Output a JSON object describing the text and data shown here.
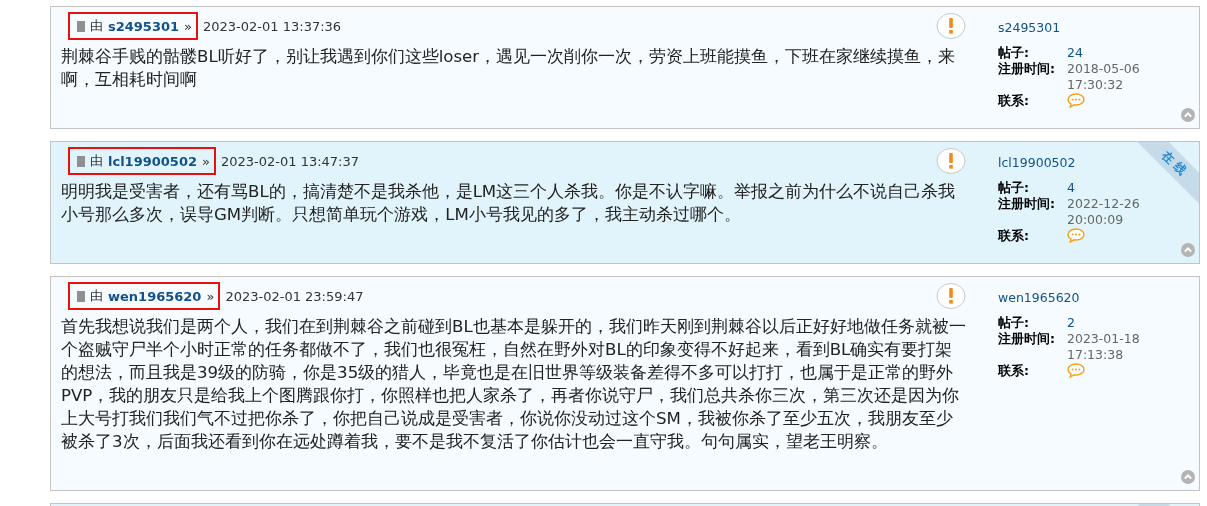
{
  "posts": [
    {
      "kind": "full",
      "online": false,
      "highlighted": true,
      "by": "由",
      "author": "s2495301",
      "sep": "»",
      "time": "2023-02-01 13:37:36",
      "content": "荆棘谷手贱的骷髅BL听好了，别让我遇到你们这些loser，遇见一次削你一次，劳资上班能摸鱼，下班在家继续摸鱼，来啊，互相耗时间啊",
      "profile": {
        "name": "s2495301",
        "posts_label": "帖子:",
        "posts": "24",
        "reg_label": "注册时间:",
        "reg": "2018-05-06 17:30:32",
        "contact_label": "联系:"
      }
    },
    {
      "kind": "full",
      "online": true,
      "status_label": "在 线",
      "highlighted": true,
      "by": "由",
      "author": "lcl19900502",
      "sep": "»",
      "time": "2023-02-01 13:47:37",
      "content": "明明我是受害者，还有骂BL的，搞清楚不是我杀他，是LM这三个人杀我。你是不认字嘛。举报之前为什么不说自己杀我小号那么多次，误导GM判断。只想简单玩个游戏，LM小号我见的多了，我主动杀过哪个。",
      "profile": {
        "name": "lcl19900502",
        "posts_label": "帖子:",
        "posts": "4",
        "reg_label": "注册时间:",
        "reg": "2022-12-26 20:00:09",
        "contact_label": "联系:"
      }
    },
    {
      "kind": "full",
      "online": false,
      "highlighted": true,
      "by": "由",
      "author": "wen1965620",
      "sep": "»",
      "time": "2023-02-01 23:59:47",
      "content": "首先我想说我们是两个人，我们在到荆棘谷之前碰到BL也基本是躲开的，我们昨天刚到荆棘谷以后正好好地做任务就被一个盗贼守尸半个小时正常的任务都做不了，我们也很冤枉，自然在野外对BL的印象变得不好起来，看到BL确实有要打架的想法，而且我是39级的防骑，你是35级的猎人，毕竟也是在旧世界等级装备差得不多可以打打，也属于是正常的野外PVP，我的朋友只是给我上个图腾跟你打，你照样也把人家杀了，再者你说守尸，我们总共杀你三次，第三次还是因为你上大号打我们我们气不过把你杀了，你把自己说成是受害者，你说你没动过这个SM，我被你杀了至少五次，我朋友至少被杀了3次，后面我还看到你在远处蹲着我，要不是我不复活了你估计也会一直守我。句句属实，望老王明察。",
      "profile": {
        "name": "wen1965620",
        "posts_label": "帖子:",
        "posts": "2",
        "reg_label": "注册时间:",
        "reg": "2023-01-18 17:13:38",
        "contact_label": "联系:"
      }
    },
    {
      "kind": "cut",
      "online": true
    }
  ]
}
